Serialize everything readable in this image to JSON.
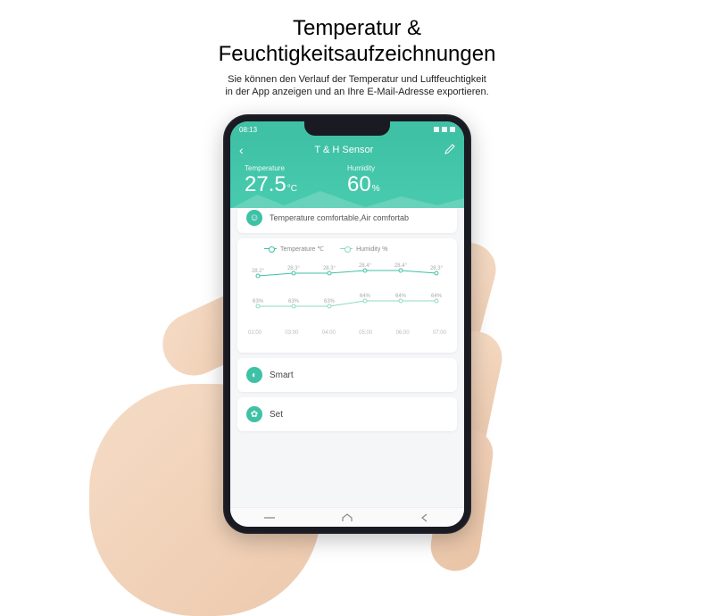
{
  "marketing": {
    "title_line1": "Temperatur &",
    "title_line2": "Feuchtigkeitsaufzeichnungen",
    "sub_line1": "Sie können den Verlauf der Temperatur und Luftfeuchtigkeit",
    "sub_line2": "in der App anzeigen und an Ihre E-Mail-Adresse exportieren."
  },
  "statusbar": {
    "time": "08:13"
  },
  "header": {
    "title": "T & H Sensor",
    "temp_label": "Temperature",
    "temp_value": "27.5",
    "temp_unit": "°C",
    "hum_label": "Humidity",
    "hum_value": "60",
    "hum_unit": "%"
  },
  "status_card": {
    "text": "Temperature comfortable,Air comfortab"
  },
  "chart": {
    "legend_temp": "Temperature ℃",
    "legend_hum": "Humidity %"
  },
  "chart_data": {
    "type": "line",
    "categories": [
      "02:00",
      "03:00",
      "04:00",
      "05:00",
      "06:00",
      "07:00"
    ],
    "series": [
      {
        "name": "Temperature ℃",
        "values": [
          28.2,
          28.3,
          28.3,
          28.4,
          28.4,
          28.3
        ],
        "color": "#3fc1a5"
      },
      {
        "name": "Humidity %",
        "values": [
          63,
          63,
          63,
          64,
          64,
          64
        ],
        "color": "#8ed9c6"
      }
    ],
    "title": "",
    "xlabel": "",
    "ylabel": ""
  },
  "actions": {
    "smart": "Smart",
    "set": "Set"
  },
  "colors": {
    "accent": "#3fc1a5"
  }
}
